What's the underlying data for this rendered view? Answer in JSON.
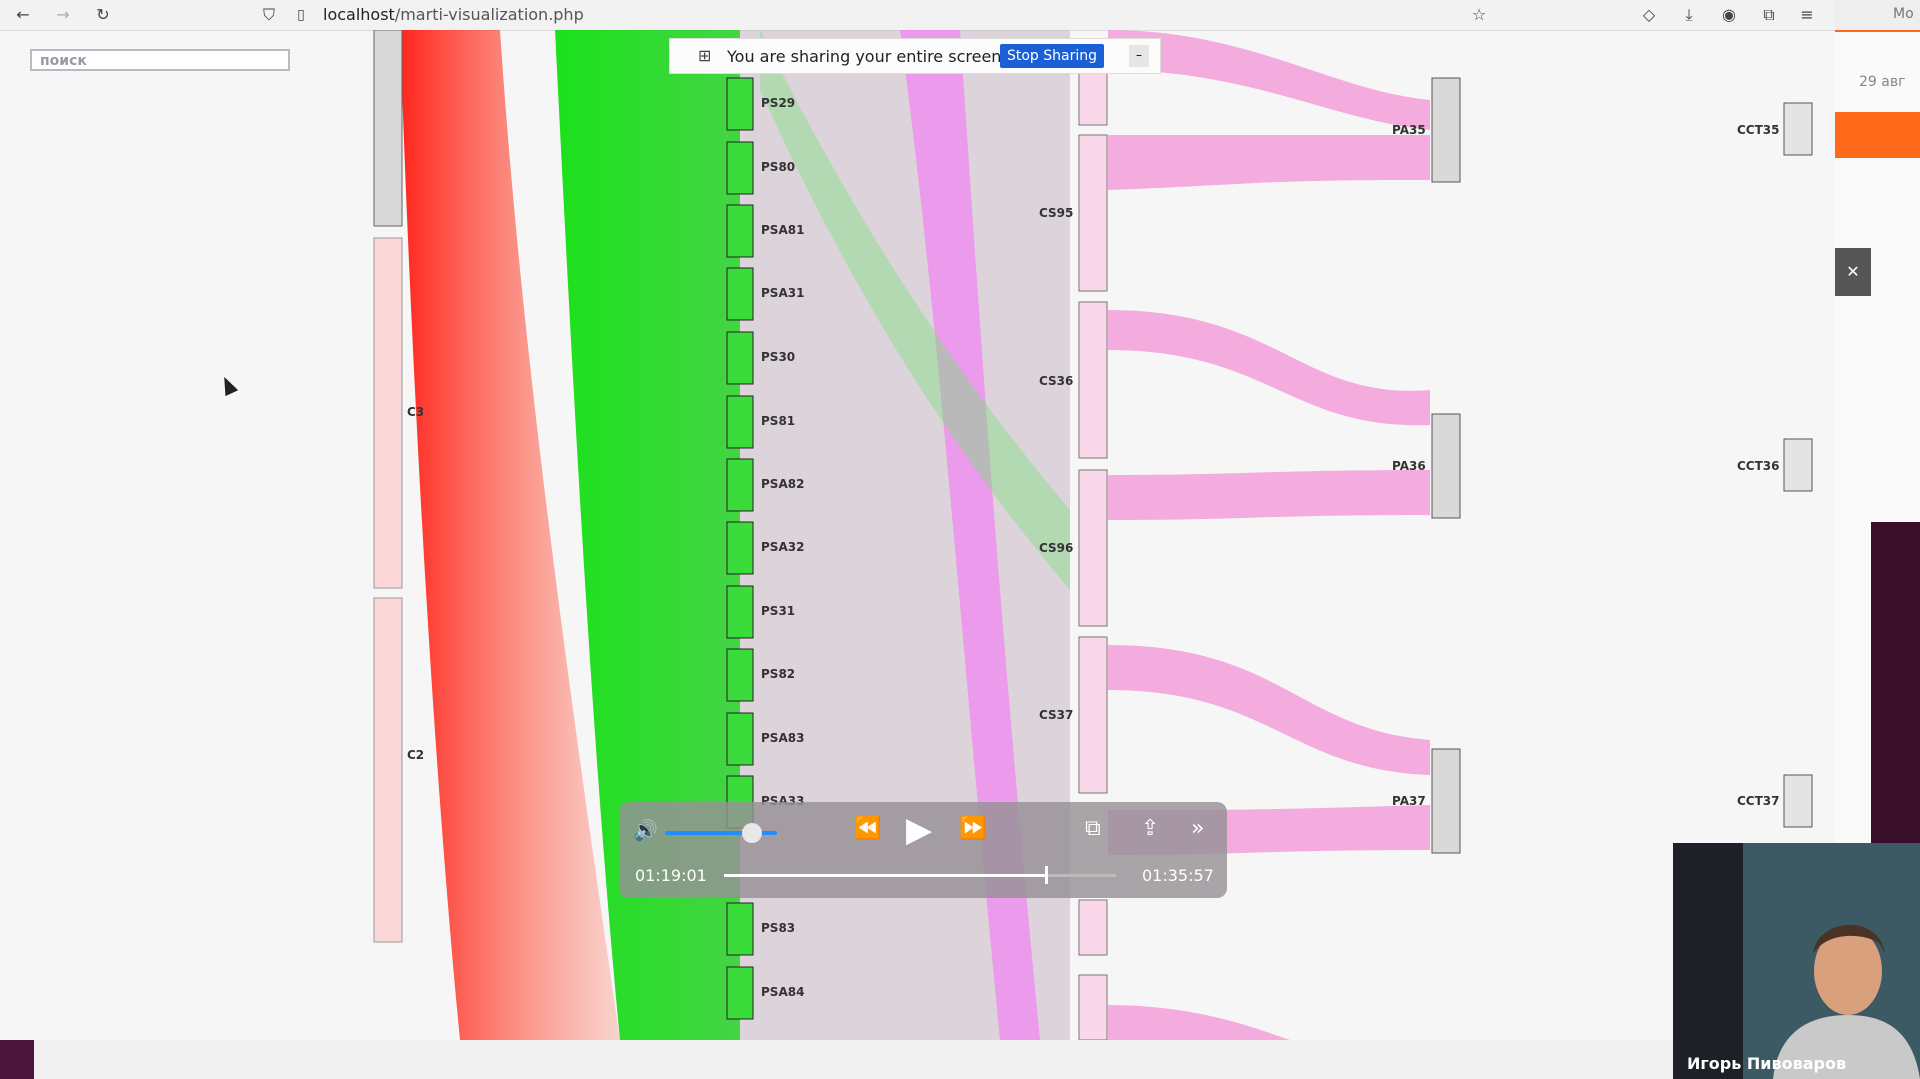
{
  "browser": {
    "url_host": "localhost",
    "url_path": "/marti-visualization.php",
    "search_placeholder": "поиск"
  },
  "share_bar": {
    "text": "You are sharing your entire screen.",
    "stop_label": "Stop Sharing"
  },
  "player": {
    "current_time": "01:19:01",
    "total_time": "01:35:57",
    "progress_fraction": 0.82,
    "volume_fraction": 0.78
  },
  "side_panel": {
    "date_fragment": "29 авг",
    "tab_fragment": "Мо"
  },
  "webcam": {
    "name": "Игорь Пивоваров"
  },
  "viz": {
    "col1": [
      "C3",
      "C2"
    ],
    "col2": [
      "PS29",
      "PS80",
      "PSA81",
      "PSA31",
      "PS30",
      "PS81",
      "PSA82",
      "PSA32",
      "PS31",
      "PS82",
      "PSA83",
      "PSA33",
      "PS83",
      "PSA84"
    ],
    "col3": [
      "CS95",
      "CS36",
      "CS96",
      "CS37"
    ],
    "col4": [
      "PA35",
      "PA36",
      "PA37"
    ],
    "col5": [
      "CCT35",
      "CCT36",
      "CCT37"
    ],
    "colors": {
      "red": "#ff2a1a",
      "green": "#22dd22",
      "pink": "#f49ad8",
      "magenta": "#ff44ff"
    }
  }
}
